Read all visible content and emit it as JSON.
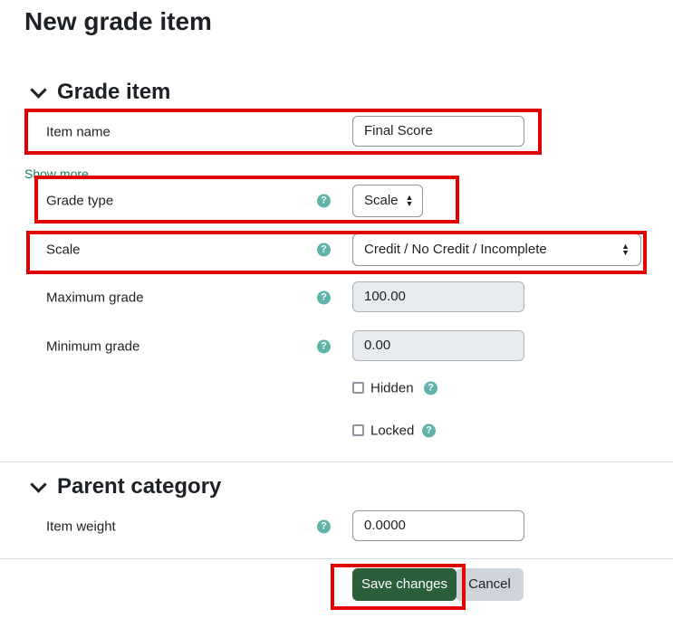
{
  "page_title": "New grade item",
  "sections": {
    "grade_item": {
      "title": "Grade item"
    },
    "parent_category": {
      "title": "Parent category"
    }
  },
  "fields": {
    "item_name": {
      "label": "Item name",
      "value": "Final Score"
    },
    "show_more": "Show more...",
    "grade_type": {
      "label": "Grade type",
      "value": "Scale"
    },
    "scale": {
      "label": "Scale",
      "value": "Credit / No Credit / Incomplete"
    },
    "maximum_grade": {
      "label": "Maximum grade",
      "value": "100.00"
    },
    "minimum_grade": {
      "label": "Minimum grade",
      "value": "0.00"
    },
    "hidden": {
      "label": "Hidden",
      "checked": false
    },
    "locked": {
      "label": "Locked",
      "checked": false
    },
    "item_weight": {
      "label": "Item weight",
      "value": "0.0000"
    }
  },
  "help_glyph": "?",
  "buttons": {
    "save": "Save changes",
    "cancel": "Cancel"
  },
  "colors": {
    "primary": "#2b5f3a",
    "link": "#1a7f5a",
    "help": "#5fb3a8",
    "highlight": "#e00000"
  }
}
